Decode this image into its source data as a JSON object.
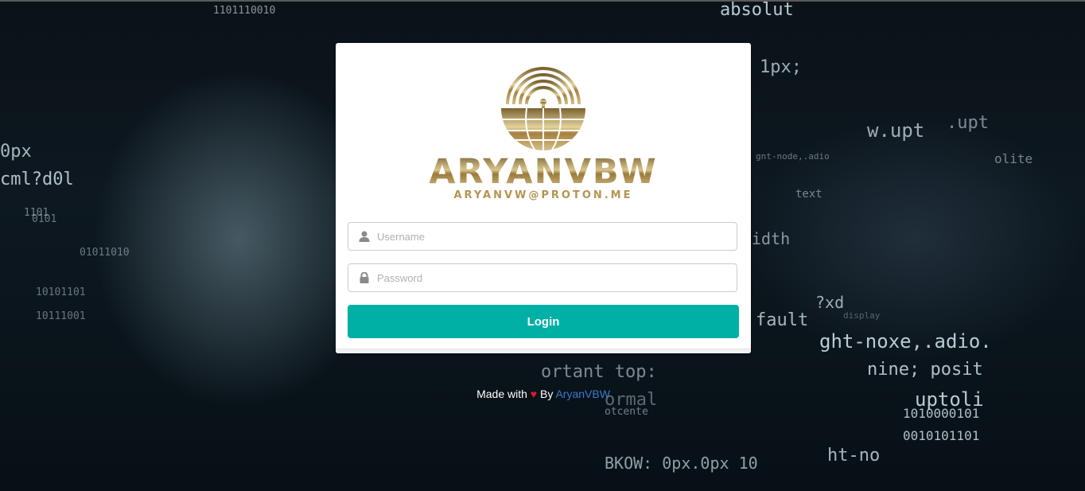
{
  "brand": {
    "name": "ARYANVBW",
    "email": "ARYANVW@PROTON.ME"
  },
  "form": {
    "username_placeholder": "Username",
    "password_placeholder": "Password",
    "login_label": "Login"
  },
  "footer": {
    "made_with": "Made with",
    "heart": "♥",
    "by": "By",
    "author": "AryanVBW"
  },
  "colors": {
    "accent": "#00b0a4",
    "link": "#3a79c9",
    "gold": "#b39550",
    "heart": "#e0192e"
  },
  "background": {
    "codes": [
      "absolut",
      "0px",
      "cml?d0l",
      "1101110010",
      "1px;",
      ".upt",
      "w.upt",
      "olite",
      "1101",
      "text",
      "fault",
      "?xd",
      "ght-noxe,.adio.",
      "nine; posit",
      "uptoli",
      "1010000101",
      "0010101101",
      "ht-no",
      "ortant top:",
      "ormal",
      "otcente",
      "BKOW: 0px.0px 10",
      "idth",
      "gnt-node,.adio",
      "0101",
      "01011010",
      "10101101",
      "10111001",
      "display"
    ]
  }
}
